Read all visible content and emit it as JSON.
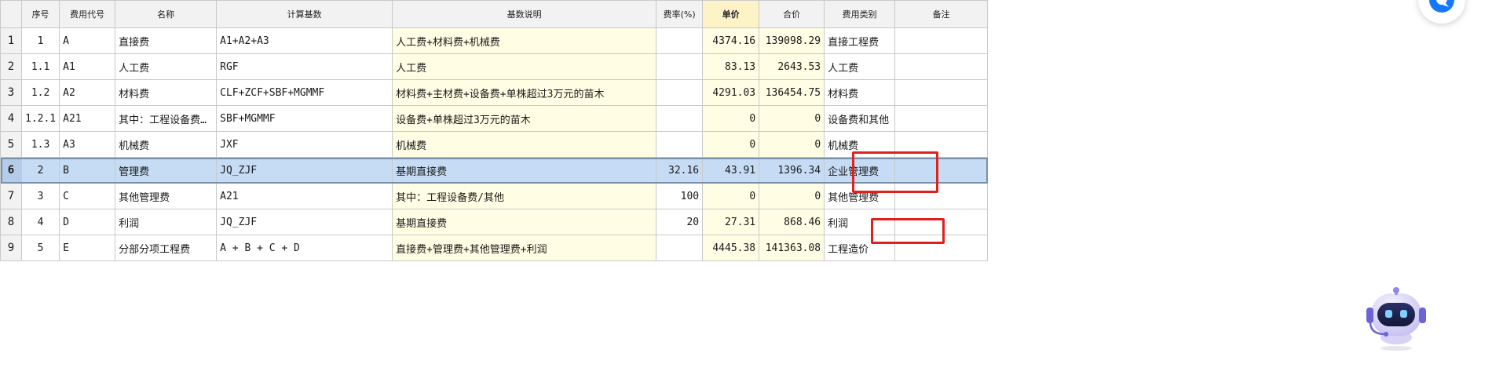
{
  "table": {
    "headers": [
      "序号",
      "费用代号",
      "名称",
      "计算基数",
      "基数说明",
      "费率(%)",
      "单价",
      "合价",
      "费用类别",
      "备注"
    ],
    "rows": [
      {
        "no": "1",
        "seq": "1",
        "code": "A",
        "name": "直接费",
        "base": "A1+A2+A3",
        "desc": "人工费+材料费+机械费",
        "rate": "",
        "price": "4374.16",
        "total": "139098.29",
        "category": "直接工程费",
        "remark": ""
      },
      {
        "no": "2",
        "seq": "1.1",
        "code": "A1",
        "name": "人工费",
        "base": "RGF",
        "desc": "人工费",
        "rate": "",
        "price": "83.13",
        "total": "2643.53",
        "category": "人工费",
        "remark": ""
      },
      {
        "no": "3",
        "seq": "1.2",
        "code": "A2",
        "name": "材料费",
        "base": "CLF+ZCF+SBF+MGMMF",
        "desc": "材料费+主材费+设备费+单株超过3万元的苗木",
        "rate": "",
        "price": "4291.03",
        "total": "136454.75",
        "category": "材料费",
        "remark": ""
      },
      {
        "no": "4",
        "seq": "1.2.1",
        "code": "A21",
        "name": "其中：工程设备费…",
        "base": "SBF+MGMMF",
        "desc": "设备费+单株超过3万元的苗木",
        "rate": "",
        "price": "0",
        "total": "0",
        "category": "设备费和其他",
        "remark": ""
      },
      {
        "no": "5",
        "seq": "1.3",
        "code": "A3",
        "name": "机械费",
        "base": "JXF",
        "desc": "机械费",
        "rate": "",
        "price": "0",
        "total": "0",
        "category": "机械费",
        "remark": ""
      },
      {
        "no": "6",
        "seq": "2",
        "code": "B",
        "name": "管理费",
        "base": "JQ_ZJF",
        "desc": "基期直接费",
        "rate": "32.16",
        "price": "43.91",
        "total": "1396.34",
        "category": "企业管理费",
        "remark": ""
      },
      {
        "no": "7",
        "seq": "3",
        "code": "C",
        "name": "其他管理费",
        "base": "A21",
        "desc": "其中：工程设备费/其他",
        "rate": "100",
        "price": "0",
        "total": "0",
        "category": "其他管理费",
        "remark": ""
      },
      {
        "no": "8",
        "seq": "4",
        "code": "D",
        "name": "利润",
        "base": "JQ_ZJF",
        "desc": "基期直接费",
        "rate": "20",
        "price": "27.31",
        "total": "868.46",
        "category": "利润",
        "remark": ""
      },
      {
        "no": "9",
        "seq": "5",
        "code": "E",
        "name": "分部分项工程费",
        "base": "A + B + C + D",
        "desc": "直接费+管理费+其他管理费+利润",
        "rate": "",
        "price": "4445.38",
        "total": "141363.08",
        "category": "工程造价",
        "remark": ""
      }
    ],
    "selected_row": 6
  },
  "icons": {
    "top_button": "chat-bubble-icon",
    "assistant": "robot-assistant-icon"
  },
  "colors": {
    "header_bg": "#f2f2f2",
    "highlight_header": "#fdf3c7",
    "yellow_cell": "#fffde3",
    "selected_row": "#c6dcf4",
    "annotation_red": "#e0201c",
    "accent_blue": "#1677ff"
  }
}
